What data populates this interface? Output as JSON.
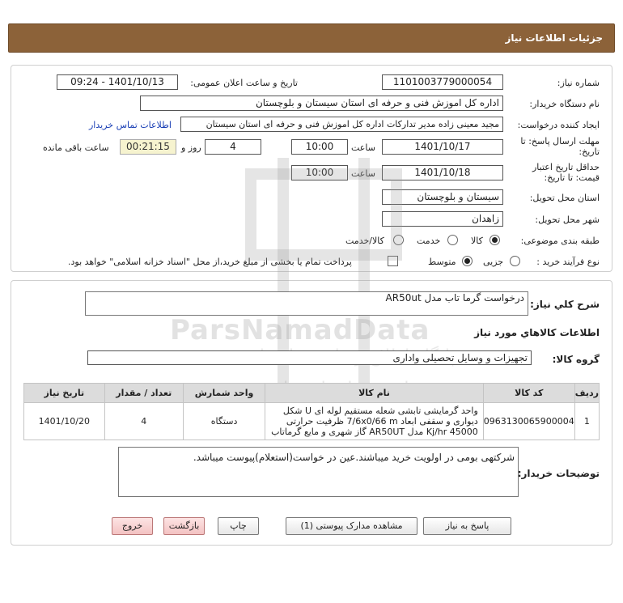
{
  "header": {
    "title": "جزئیات اطلاعات نیاز"
  },
  "form": {
    "need_number_label": "شماره نیاز:",
    "need_number": "1101003779000054",
    "announce_label": "تاریخ و ساعت اعلان عمومی:",
    "announce_value": "1401/10/13 - 09:24",
    "buyer_org_label": "نام دستگاه خریدار:",
    "buyer_org": "اداره کل اموزش فنی و حرفه ای استان سیستان و بلوچستان",
    "requester_label": "ایجاد کننده درخواست:",
    "requester": "مجید معینی زاده مدیر تدارکات اداره کل اموزش فنی و حرفه ای استان سیستان",
    "contact_link": "اطلاعات تماس خریدار",
    "deadline_label": "مهلت ارسال پاسخ: تا تاریخ:",
    "deadline_date": "1401/10/17",
    "time_label": "ساعت",
    "deadline_time": "10:00",
    "days_value": "4",
    "days_label": "روز و",
    "remaining_value": "00:21:15",
    "remaining_label": "ساعت باقی مانده",
    "validity_label": "حداقل تاریخ اعتبار قیمت: تا تاریخ:",
    "validity_date": "1401/10/18",
    "validity_time": "10:00",
    "province_label": "استان محل تحویل:",
    "province": "سیستان و بلوچستان",
    "city_label": "شهر محل تحویل:",
    "city": "زاهدان",
    "category_label": "طبقه بندی موضوعی:",
    "category_options": [
      "کالا",
      "خدمت",
      "کالا/خدمت"
    ],
    "category_selected": "کالا",
    "process_label": "نوع فرآیند خرید :",
    "process_options": [
      "جزیی",
      "متوسط"
    ],
    "process_selected": "متوسط",
    "payment_note": "پرداخت تمام یا بخشی از مبلغ خرید،از محل \"اسناد خزانه اسلامی\" خواهد بود."
  },
  "details": {
    "summary_label": "شرح کلي نياز:",
    "summary": "درخواست گرما تاب مدل AR50ut",
    "goods_info_title": "اطلاعات کالاهاي مورد نياز",
    "goods_group_label": "گروه کالا:",
    "goods_group": "تجهیزات و وسایل تحصیلی واداری",
    "table": {
      "headers": [
        "ردیف",
        "کد کالا",
        "نام کالا",
        "واحد شمارش",
        "تعداد / مقدار",
        "تاریخ نیاز"
      ],
      "rows": [
        {
          "index": "1",
          "code": "0963130065900004",
          "name": "واحد گرمایشی تابشی شعله مستقیم لوله ای U شکل دیواری و سقفی ابعاد 7/6x0/66 m ظرفیت حرارتی 45000 Kj/hr مدل AR50UT گاز شهری و مایع گرماتاب",
          "unit": "دستگاه",
          "qty": "4",
          "date": "1401/10/20"
        }
      ]
    },
    "buyer_notes_label": "توضیحات خریدار:",
    "buyer_notes": "شرکتهی بومی در اولویت خرید میباشند.عین در خواست(استعلام)پیوست میباشد."
  },
  "buttons": {
    "reply": "پاسخ به نیاز",
    "view_docs": "مشاهده مدارک پیوستی (1)",
    "print": "چاپ",
    "back": "بازگشت",
    "exit": "خروج"
  },
  "watermark": {
    "brand": "ParsNamadData",
    "line1": "پایگاه اطلاع رسانی مناقصات",
    "line2": "پارس نماد داده ها"
  }
}
